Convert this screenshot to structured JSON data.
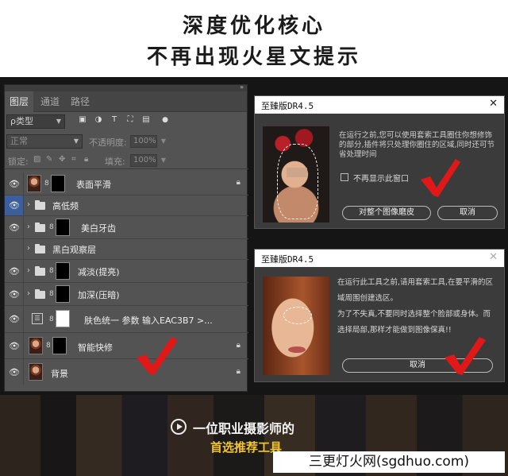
{
  "header": {
    "line1": "深度优化核心",
    "line2": "不再出现火星文提示"
  },
  "layers_panel": {
    "tabs": [
      "图层",
      "通道",
      "路径"
    ],
    "filter_label": "ρ类型",
    "blend_mode": "正常",
    "opacity_label": "不透明度:",
    "opacity_value": "100%",
    "lock_label": "锁定:",
    "fill_label": "填充:",
    "fill_value": "100%",
    "layers": [
      {
        "name": "表面平滑",
        "visible": true,
        "locked": true
      },
      {
        "name": "高低频",
        "visible": true,
        "group": true
      },
      {
        "name": "美白牙齿",
        "visible": true,
        "group": true
      },
      {
        "name": "黑白观察层",
        "visible": false,
        "group": true
      },
      {
        "name": "减淡(提亮)",
        "visible": true,
        "group": true
      },
      {
        "name": "加深(压暗)",
        "visible": true,
        "group": true
      },
      {
        "name": "肤色统一  参数  输入EAC3B7 >...",
        "visible": true,
        "adjustment": true
      },
      {
        "name": "智能快修",
        "visible": true,
        "locked": true
      },
      {
        "name": "背景",
        "visible": true,
        "locked": true
      }
    ]
  },
  "dialog1": {
    "title": "至臻版DR4.5",
    "message": "在运行之前,您可以使用套索工具圈住你想修饰的部分,插件将只处理你圈住的区域,同时还可节省处理时间",
    "checkbox_label": "不再显示此窗口",
    "button_primary": "对整个图像磨皮",
    "button_cancel": "取消"
  },
  "dialog2": {
    "title": "至臻版DR4.5",
    "message_lines": [
      "在运行此工具之前,请用套索工具,在要平滑的区",
      "域周围创建选区。",
      "为了不失真,不要同时选择整个脸部或身体。而",
      "选择局部,那样才能做到图像保真!!"
    ],
    "button_cancel": "取消"
  },
  "footer": {
    "line1": "一位职业摄影师的",
    "line2": "首选推荐工具"
  },
  "watermark": "三更灯火网(sgdhuo.com)",
  "colors": {
    "check_red": "#e01818",
    "accent_yellow": "#f4c52a",
    "selected_eye_blue": "#3a5f9a"
  }
}
